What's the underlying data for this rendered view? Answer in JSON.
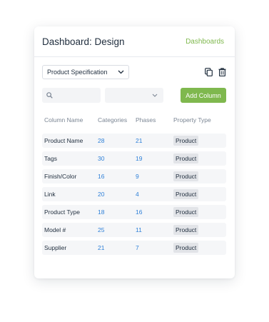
{
  "header": {
    "title": "Dashboard: Design",
    "link_label": "Dashboards"
  },
  "toolbar": {
    "select_value": "Product Specification"
  },
  "filters": {
    "search_placeholder": "",
    "add_label": "Add Column"
  },
  "table": {
    "headers": [
      "Column Name",
      "Categories",
      "Phases",
      "Property Type"
    ],
    "rows": [
      {
        "name": "Product Name",
        "categories": "28",
        "phases": "21",
        "type": "Product"
      },
      {
        "name": "Tags",
        "categories": "30",
        "phases": "19",
        "type": "Product"
      },
      {
        "name": "Finish/Color",
        "categories": "16",
        "phases": "9",
        "type": "Product"
      },
      {
        "name": "Link",
        "categories": "20",
        "phases": "4",
        "type": "Product"
      },
      {
        "name": "Product Type",
        "categories": "18",
        "phases": "16",
        "type": "Product"
      },
      {
        "name": "Model #",
        "categories": "25",
        "phases": "11",
        "type": "Product"
      },
      {
        "name": "Supplier",
        "categories": "21",
        "phases": "7",
        "type": "Product"
      }
    ]
  },
  "icons": {
    "select_chevron": "chevron-down-icon",
    "copy": "copy-icon",
    "delete": "trash-icon",
    "search": "search-icon",
    "filter_chevron": "chevron-down-icon"
  },
  "colors": {
    "accent": "#7fb84e",
    "number": "#2f80d8",
    "pill_bg": "#e2e4e8"
  }
}
